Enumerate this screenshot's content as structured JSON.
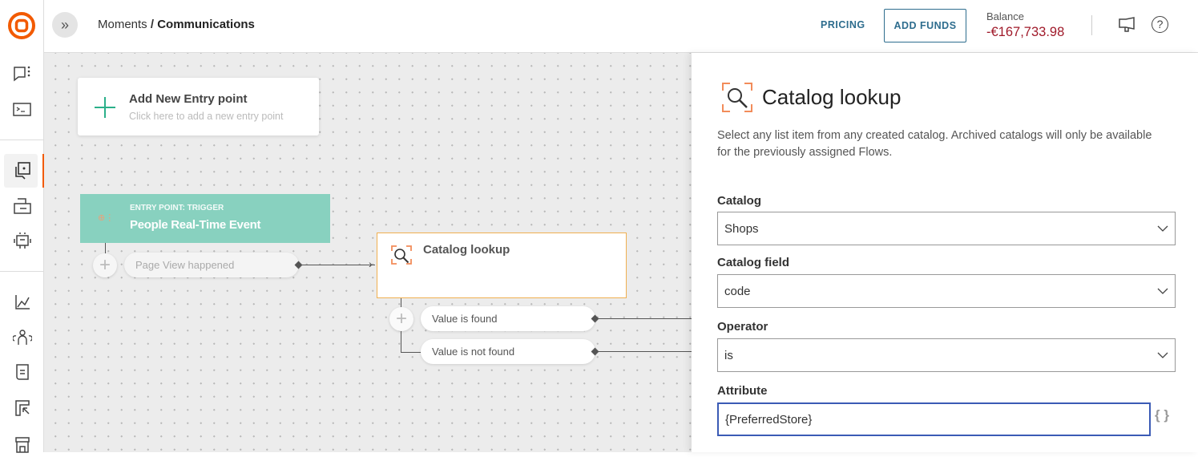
{
  "header": {
    "breadcrumb_parent": "Moments",
    "breadcrumb_sep": " / ",
    "breadcrumb_current": "Communications",
    "pricing": "PRICING",
    "add_funds": "ADD FUNDS",
    "balance_label": "Balance",
    "balance_value": "-€167,733.98"
  },
  "canvas": {
    "add_entry_title": "Add New Entry point",
    "add_entry_subtitle": "Click here to add a new entry point",
    "trigger_label": "ENTRY POINT: TRIGGER",
    "trigger_title": "People Real-Time Event",
    "trigger_event": "Page View happened",
    "node_title": "Catalog lookup",
    "branch_found": "Value is found",
    "branch_not_found": "Value is not found"
  },
  "panel": {
    "title": "Catalog lookup",
    "description": "Select any list item from any created catalog. Archived catalogs will only be available for the previously assigned Flows.",
    "catalog_label": "Catalog",
    "catalog_value": "Shops",
    "field_label": "Catalog field",
    "field_value": "code",
    "operator_label": "Operator",
    "operator_value": "is",
    "attribute_label": "Attribute",
    "attribute_value": "{PreferredStore}",
    "braces": "{ }"
  },
  "colors": {
    "brand": "#f25a00",
    "teal": "#88d1bf",
    "balance": "#a01a2a",
    "link": "#2e6d8e",
    "focus": "#3b5bb5",
    "node_border": "#f0b050"
  }
}
